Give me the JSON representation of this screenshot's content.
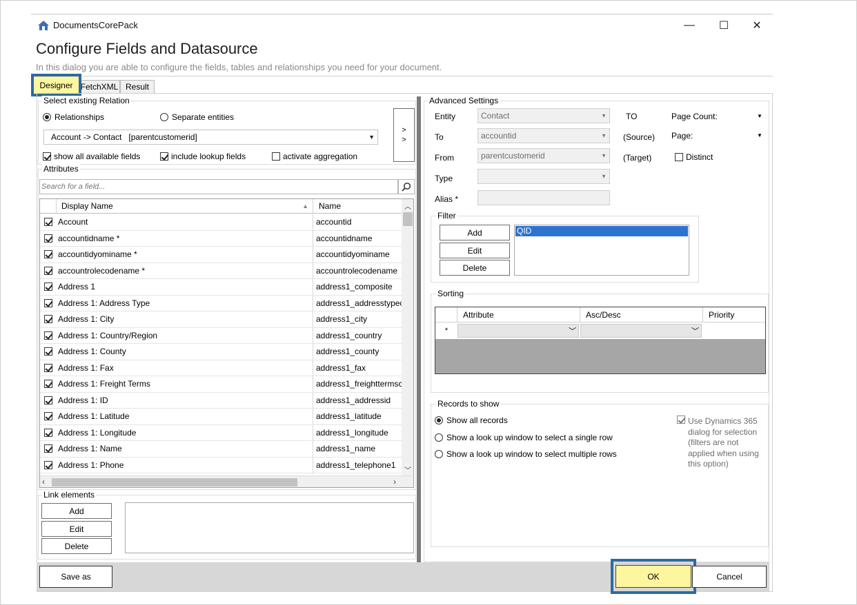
{
  "window": {
    "app_title": "DocumentsCorePack",
    "minimize_glyph": "—",
    "maximize_glyph": "☐",
    "close_glyph": "✕"
  },
  "header": {
    "title": "Configure Fields and Datasource",
    "subtitle": "In this dialog you are able to configure the fields, tables and relationships you need for your document."
  },
  "tabs": [
    {
      "label": "Designer",
      "active": true
    },
    {
      "label": "FetchXML",
      "active": false
    },
    {
      "label": "Result",
      "active": false
    }
  ],
  "relation": {
    "group_label": "Select existing Relation",
    "radio_relationships": "Relationships",
    "radio_separate": "Separate entities",
    "selected_relation": "Account -> Contact   [parentcustomerid]",
    "move_button": "> >",
    "chk_show_all": "show all available fields",
    "chk_include_lookup": "include lookup fields",
    "chk_aggregation": "activate aggregation"
  },
  "attributes": {
    "group_label": "Attributes",
    "search_placeholder": "Search for a field...",
    "col_display": "Display Name",
    "col_name": "Name",
    "rows": [
      {
        "display": "Account",
        "name": "accountid"
      },
      {
        "display": "accountidname *",
        "name": "accountidname"
      },
      {
        "display": "accountidyominame *",
        "name": "accountidyominame"
      },
      {
        "display": "accountrolecodename *",
        "name": "accountrolecodename"
      },
      {
        "display": "Address 1",
        "name": "address1_composite"
      },
      {
        "display": "Address 1: Address Type",
        "name": "address1_addresstypec"
      },
      {
        "display": "Address 1: City",
        "name": "address1_city"
      },
      {
        "display": "Address 1: Country/Region",
        "name": "address1_country"
      },
      {
        "display": "Address 1: County",
        "name": "address1_county"
      },
      {
        "display": "Address 1: Fax",
        "name": "address1_fax"
      },
      {
        "display": "Address 1: Freight Terms",
        "name": "address1_freighttermsc"
      },
      {
        "display": "Address 1: ID",
        "name": "address1_addressid"
      },
      {
        "display": "Address 1: Latitude",
        "name": "address1_latitude"
      },
      {
        "display": "Address 1: Longitude",
        "name": "address1_longitude"
      },
      {
        "display": "Address 1: Name",
        "name": "address1_name"
      },
      {
        "display": "Address 1: Phone",
        "name": "address1_telephone1"
      }
    ]
  },
  "link_elements": {
    "group_label": "Link elements",
    "add": "Add",
    "edit": "Edit",
    "delete": "Delete"
  },
  "advanced": {
    "group_label": "Advanced Settings",
    "entity_label": "Entity",
    "entity_value": "Contact",
    "to_label": "To",
    "to_value": "accountid",
    "from_label": "From",
    "from_value": "parentcustomerid",
    "type_label": "Type",
    "alias_label": "Alias *",
    "to_caption": "TO",
    "source_caption": "(Source)",
    "target_caption": "(Target)",
    "page_count_label": "Page Count:",
    "page_label": "Page:",
    "distinct_label": "Distinct"
  },
  "filter": {
    "group_label": "Filter",
    "add": "Add",
    "edit": "Edit",
    "delete": "Delete",
    "items": [
      "QID"
    ]
  },
  "sorting": {
    "group_label": "Sorting",
    "col_attribute": "Attribute",
    "col_ascdesc": "Asc/Desc",
    "col_priority": "Priority",
    "new_row_marker": "*"
  },
  "records": {
    "group_label": "Records to show",
    "opt_all": "Show all records",
    "opt_single": "Show a look up window to select a single row",
    "opt_multiple": "Show a look up window to select multiple rows",
    "dynamics_note": "Use Dynamics 365 dialog for selection (filters are not applied when using this option)"
  },
  "footer": {
    "save_as": "Save as",
    "ok": "OK",
    "cancel": "Cancel"
  }
}
